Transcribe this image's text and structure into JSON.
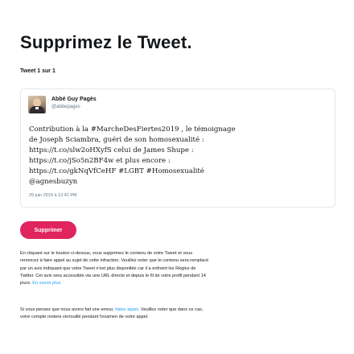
{
  "page_title": "Supprimez le Tweet.",
  "counter": "Tweet 1 sur 1",
  "tweet": {
    "display_name": "Abbé Guy Pagès",
    "handle": "@abbepages",
    "text_lines": [
      "Contribution à la #MarcheDesFiertes2019 , le témoignage",
      "de Joseph Sciambra, guéri de son homosexualité :",
      "https://t.co/slw2oHXyfS celui de James Shupe :",
      "https://t.co/jSo5n2BF4w et plus encore :",
      "https://t.co/gkNqVfCeHF #LGBT #Homosexualité",
      "@agnesbuzyn"
    ],
    "date": "29 juin 2019 à 12:41 PM"
  },
  "delete_button_label": "Supprimer",
  "notice": {
    "paragraph1_lines": [
      "En cliquant sur le bouton ci-dessus, vous supprimez le contenu de votre Tweet et vous",
      "renoncez à faire appel au sujet de cette infraction. Veuillez noter que le contenu sera remplacé",
      "par un avis indiquant que votre Tweet n'est plus disponible car il a enfreint les Règles de",
      "Twitter. Cet avis sera accessible via une URL directe et depuis le fil de votre profil pendant 14",
      "jours."
    ],
    "learn_more_link": "En savoir plus",
    "paragraph2_before_link": "Si vous pensez que nous avons fait une erreur, ",
    "appeal_link": "faites appel",
    "paragraph2_after_link": ". Veuillez noter que dans ce cas,",
    "paragraph2_line2": "votre compte restera verrouillé pendant l'examen de votre appel."
  },
  "colors": {
    "accent": "#e0245e",
    "link": "#1da1f2",
    "border": "#e1e8ed",
    "secondary_text": "#657786"
  }
}
